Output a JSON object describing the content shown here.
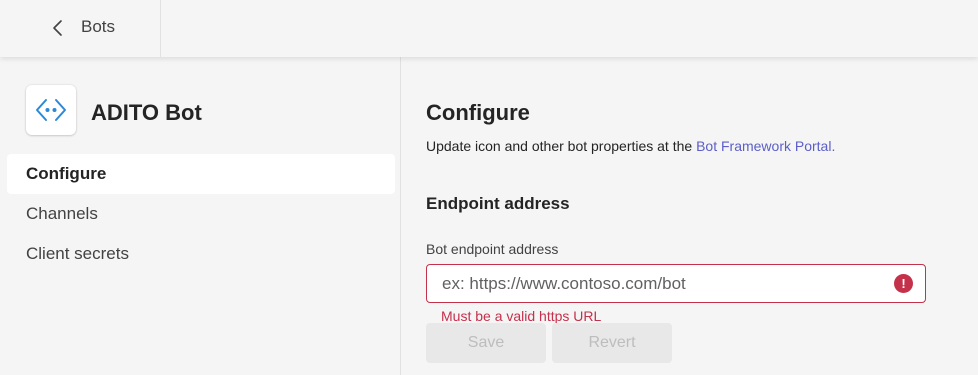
{
  "header": {
    "back_label": "Bots"
  },
  "bot": {
    "name": "ADITO Bot",
    "logo_icon": "bot-code-icon"
  },
  "sidebar": {
    "items": [
      {
        "label": "Configure",
        "active": true
      },
      {
        "label": "Channels",
        "active": false
      },
      {
        "label": "Client secrets",
        "active": false
      }
    ]
  },
  "main": {
    "title": "Configure",
    "description_prefix": "Update icon and other bot properties at the ",
    "description_link": "Bot Framework Portal.",
    "endpoint_heading": "Endpoint address",
    "endpoint_field": {
      "label": "Bot endpoint address",
      "value": "",
      "placeholder": "ex: https://www.contoso.com/bot",
      "error_icon": "!",
      "error_message": "Must be a valid https URL"
    },
    "buttons": {
      "save": "Save",
      "revert": "Revert"
    }
  },
  "colors": {
    "accent_link": "#5b5fc7",
    "error": "#c4314b",
    "bot_logo_blue": "#2b88d8"
  }
}
